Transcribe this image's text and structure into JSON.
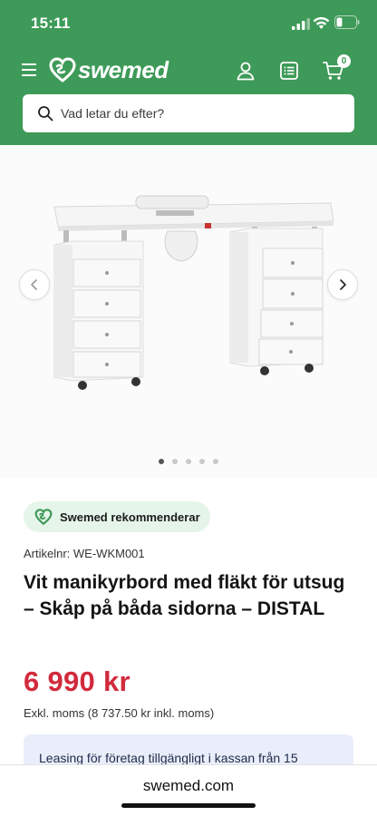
{
  "status_bar": {
    "time": "15:11"
  },
  "header": {
    "logo_text": "swemed",
    "cart_count": "0",
    "search": {
      "placeholder": "Vad letar du efter?"
    }
  },
  "gallery": {
    "slide_count": 5,
    "active_slide": 1
  },
  "product": {
    "recommend_label": "Swemed rekommenderar",
    "article_number": "Artikelnr: WE-WKM001",
    "title": "Vit manikyrbord med fläkt för utsug – Skåp på båda sidorna – DISTAL",
    "price": "6 990 kr",
    "vat_info": "Exkl. moms (8 737.50 kr inkl. moms)",
    "leasing": "Leasing för företag tillgängligt i kassan från 15"
  },
  "browser": {
    "url": "swemed.com"
  },
  "colors": {
    "brand_green": "#3e9a58",
    "price_red": "#d22a3c",
    "leasing_bg": "#e9eefa"
  }
}
